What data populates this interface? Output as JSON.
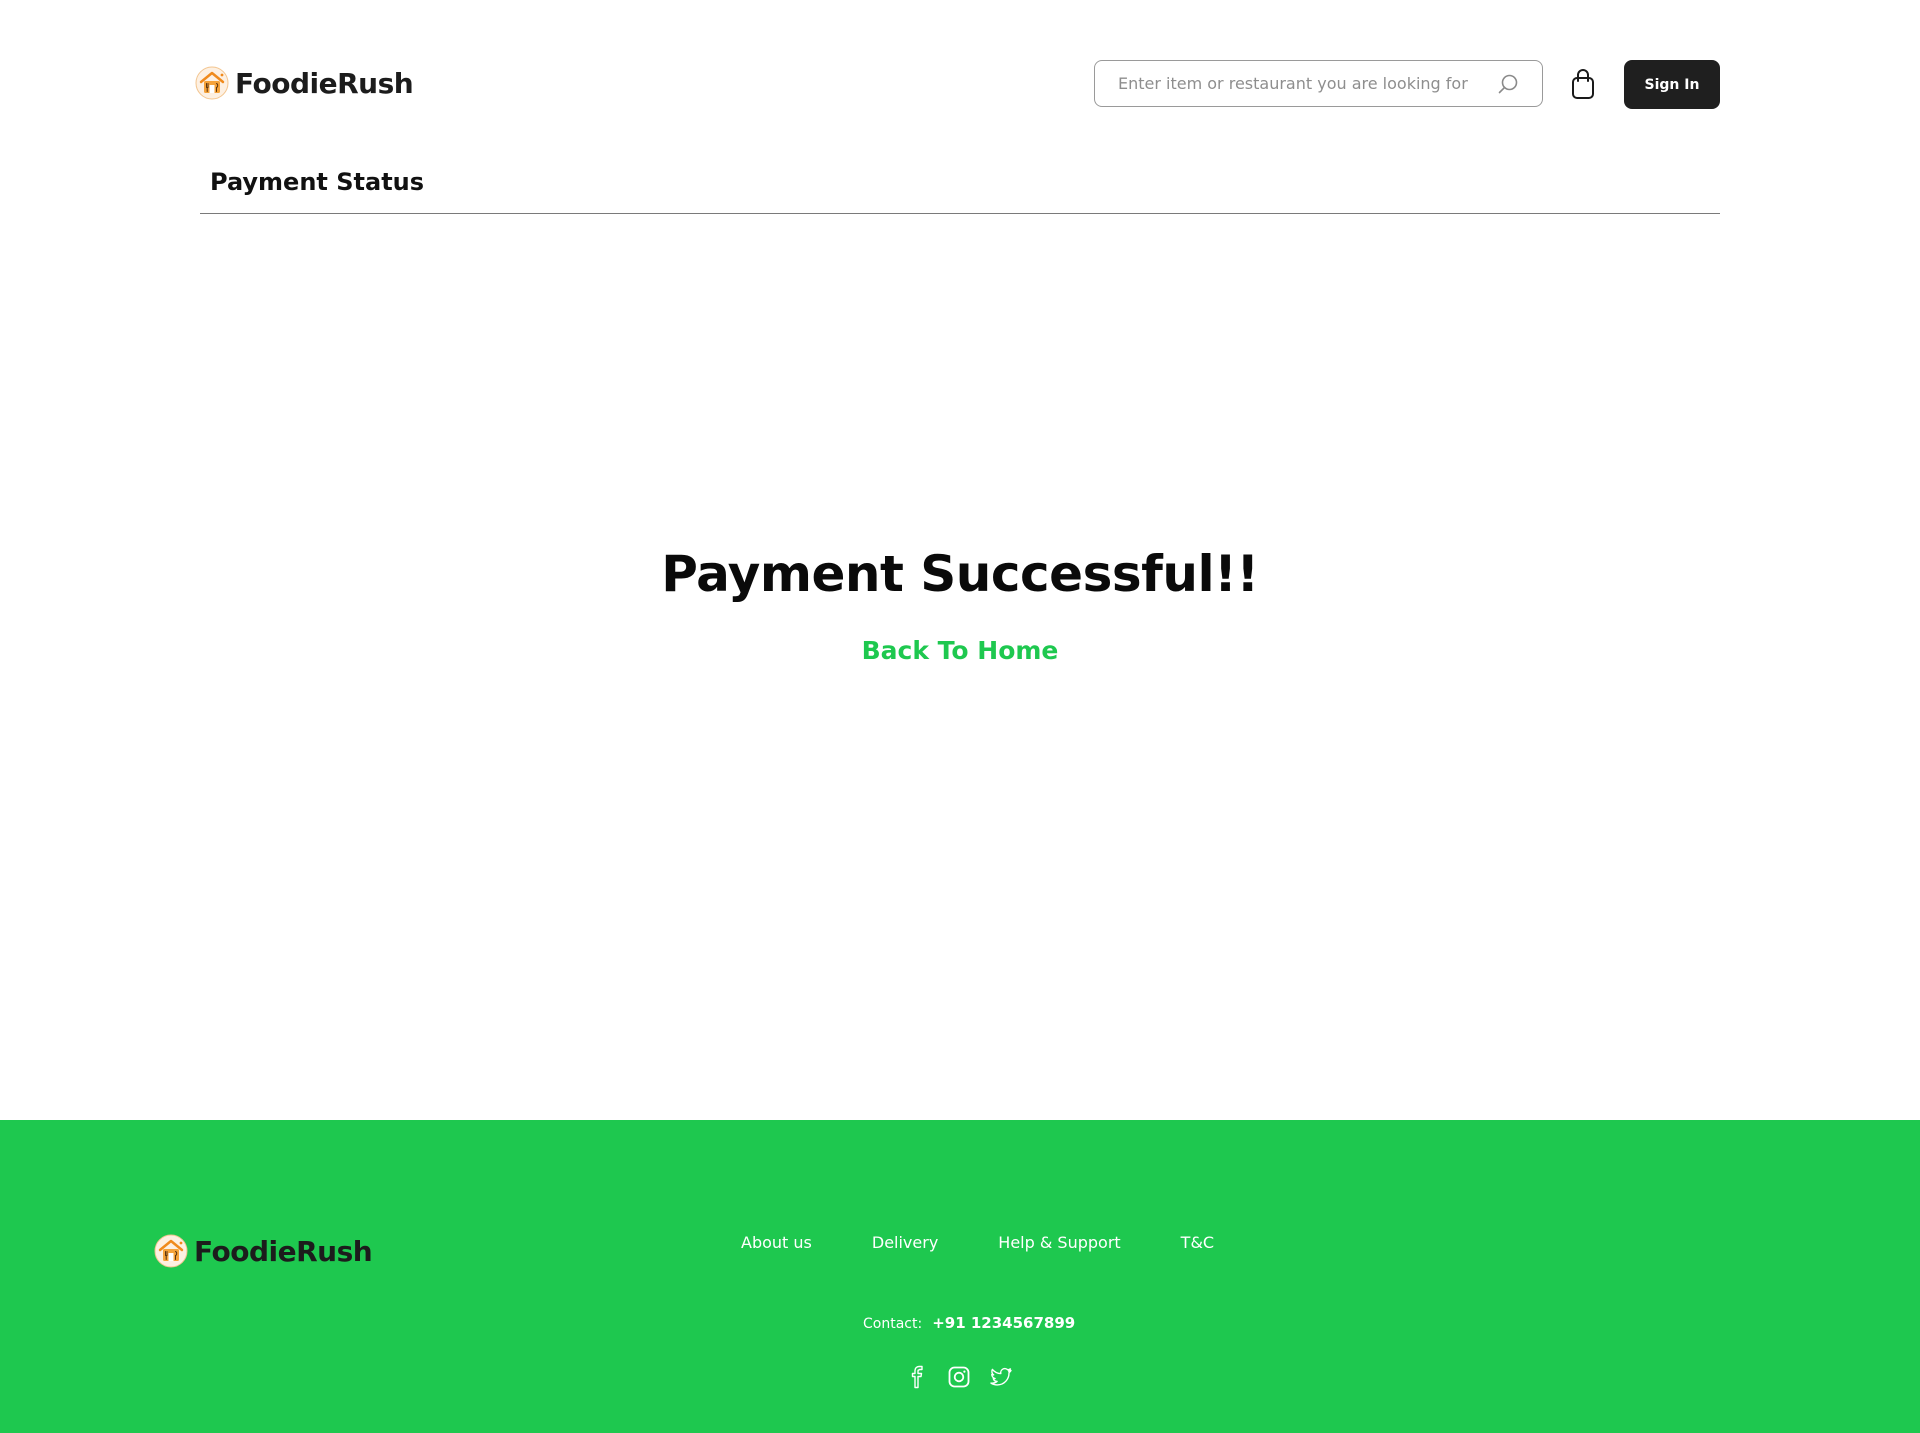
{
  "brand": {
    "name": "FoodieRush",
    "logo_icon": "restaurant-house-logo-icon"
  },
  "header": {
    "search": {
      "placeholder": "Enter item or restaurant you are looking for",
      "value": "",
      "icon": "search-icon"
    },
    "cart_icon": "shopping-bag-icon",
    "sign_in_label": "Sign In"
  },
  "page": {
    "title": "Payment Status"
  },
  "status": {
    "heading": "Payment Successful!!",
    "back_link": "Back To Home"
  },
  "footer": {
    "links": [
      "About us",
      "Delivery",
      "Help & Support",
      "T&C"
    ],
    "contact_label": "Contact:",
    "contact_phone": "+91 1234567899",
    "social_icons": [
      "facebook-icon",
      "instagram-icon",
      "twitter-icon"
    ]
  },
  "colors": {
    "accent_green": "#1ec84f",
    "button_dark": "#1f1f1f",
    "text_dark": "#111111",
    "logo_orange": "#f08a1c"
  }
}
